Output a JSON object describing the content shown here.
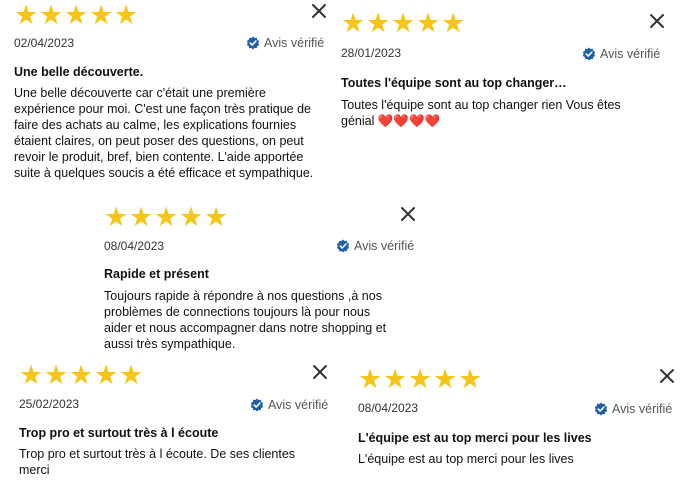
{
  "reviews": [
    {
      "rating": 5,
      "date": "02/04/2023",
      "verified_label": "Avis vérifié",
      "title": "Une belle découverte.",
      "body": "Une belle découverte car c'était une première expérience pour moi. C'est une façon très pratique de faire des achats au calme, les explications fournies étaient claires, on peut poser des questions, on peut revoir le produit, bref, bien contente. L'aide apportée suite à quelques soucis a été efficace et sympathique."
    },
    {
      "rating": 5,
      "date": "28/01/2023",
      "verified_label": "Avis vérifié",
      "title": "Toutes l'équipe sont au top changer…",
      "body": "Toutes l'équipe sont au top changer rien Vous êtes génial ❤️❤️❤️❤️"
    },
    {
      "rating": 5,
      "date": "08/04/2023",
      "verified_label": "Avis vérifié",
      "title": "Rapide et présent",
      "body": "Toujours rapide à répondre à nos questions ,à nos problèmes de connections toujours là pour nous aider et nous accompagner dans notre shopping et aussi très sympathique."
    },
    {
      "rating": 5,
      "date": "25/02/2023",
      "verified_label": "Avis vérifié",
      "title": "Trop pro et surtout très à l écoute",
      "body": "Trop pro et surtout très à l écoute. De ses clientes merci"
    },
    {
      "rating": 5,
      "date": "08/04/2023",
      "verified_label": "Avis vérifié",
      "title": "L'équipe est au top merci pour les lives",
      "body": "L'équipe est au top merci pour les lives"
    }
  ],
  "colors": {
    "star": "#f5c518",
    "verified_badge": "#1f5fa8",
    "close_icon": "#333333"
  },
  "icons": {
    "star": "star-icon",
    "close": "close-icon",
    "verified": "verified-badge-icon"
  }
}
